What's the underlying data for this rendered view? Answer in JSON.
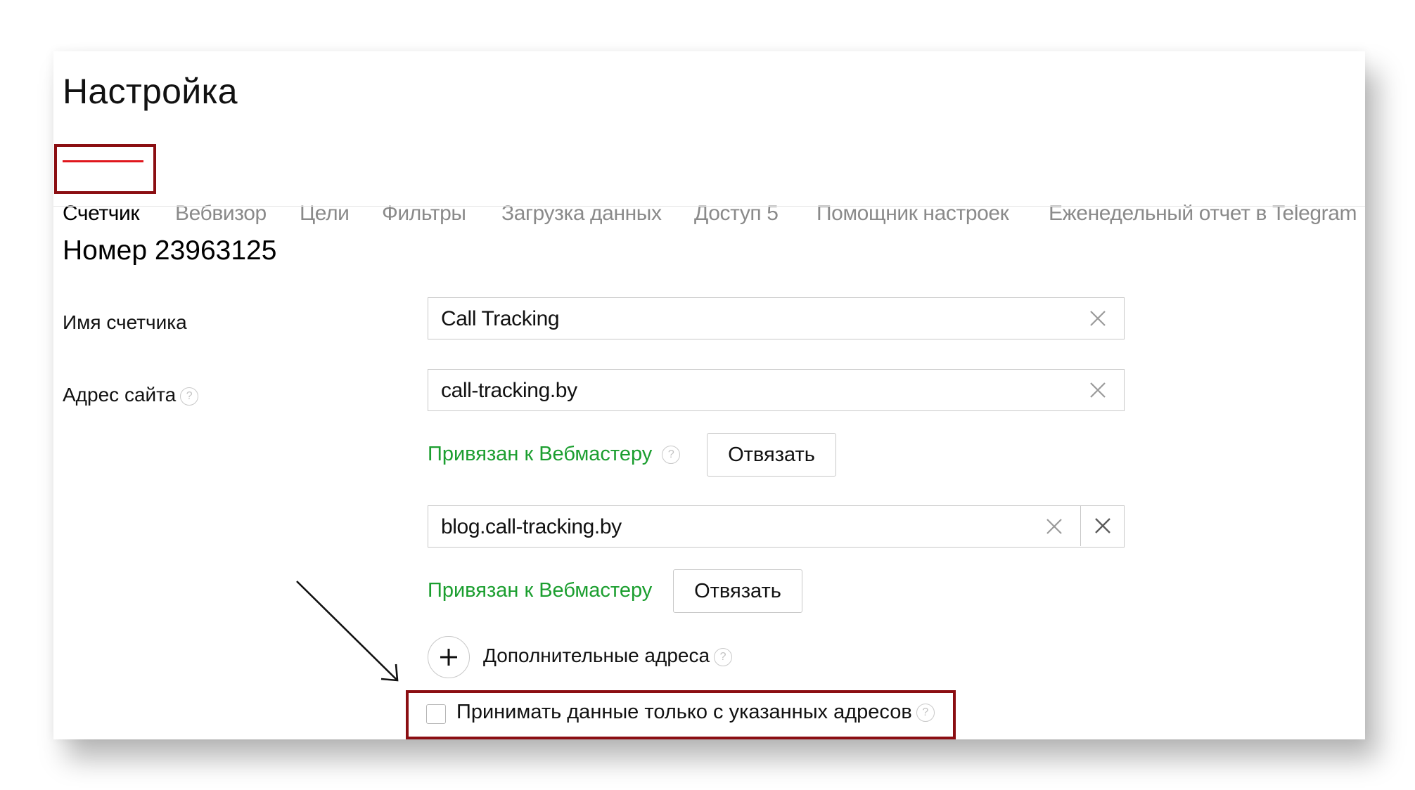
{
  "page": {
    "title": "Настройка"
  },
  "tabs": [
    {
      "label": "Счетчик",
      "active": true
    },
    {
      "label": "Вебвизор"
    },
    {
      "label": "Цели"
    },
    {
      "label": "Фильтры"
    },
    {
      "label": "Загрузка данных"
    },
    {
      "label": "Доступ 5"
    },
    {
      "label": "Помощник настроек"
    },
    {
      "label": "Еженедельный отчет в Telegram"
    }
  ],
  "counter": {
    "heading": "Номер 23963125",
    "name_label": "Имя счетчика",
    "name_value": "Call Tracking",
    "site_label": "Адрес сайта",
    "sites": [
      {
        "value": "call-tracking.by",
        "status": "Привязан к Вебмастеру",
        "unlink_label": "Отвязать"
      },
      {
        "value": "blog.call-tracking.by",
        "status": "Привязан к Вебмастеру",
        "unlink_label": "Отвязать"
      }
    ],
    "additional_addresses_label": "Дополнительные адреса",
    "only_listed_label": "Принимать данные только с указанных адресов",
    "only_listed_checked": false
  },
  "help_glyph": "?",
  "colors": {
    "accent_underline": "#e0171d",
    "highlight_box": "#8b0e12",
    "linked_status": "#1b9e2f",
    "inactive_tab": "#8a8a8a"
  },
  "icons": [
    "clear-icon",
    "close-icon",
    "plus-icon",
    "help-icon",
    "annotation-arrow-icon"
  ]
}
